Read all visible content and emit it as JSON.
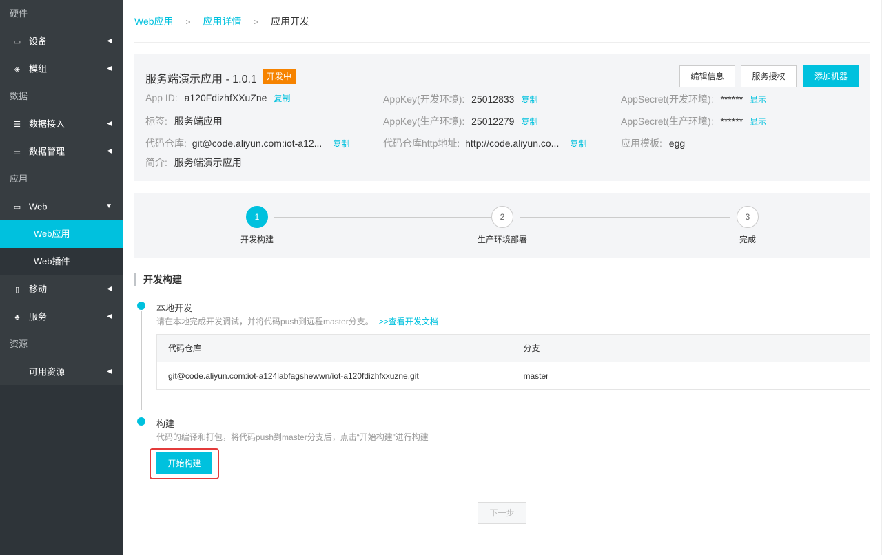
{
  "sidebar": {
    "sections": {
      "hardware": "硬件",
      "data": "数据",
      "app": "应用",
      "resources": "资源"
    },
    "items": {
      "device": {
        "label": "设备",
        "icon": "device-icon"
      },
      "module": {
        "label": "模组",
        "icon": "layers-icon"
      },
      "data_access": {
        "label": "数据接入",
        "icon": "list-icon"
      },
      "data_manage": {
        "label": "数据管理",
        "icon": "list-icon"
      },
      "web": {
        "label": "Web",
        "icon": "monitor-icon"
      },
      "web_app": {
        "label": "Web应用"
      },
      "web_plugin": {
        "label": "Web插件"
      },
      "mobile": {
        "label": "移动",
        "icon": "mobile-icon"
      },
      "service": {
        "label": "服务",
        "icon": "cluster-icon"
      },
      "available_res": {
        "label": "可用资源"
      }
    }
  },
  "breadcrumb": {
    "items": [
      "Web应用",
      "应用详情"
    ],
    "current": "应用开发",
    "separator": ">"
  },
  "app": {
    "title": "服务端演示应用 - 1.0.1",
    "status": "开发中",
    "buttons": {
      "edit": "编辑信息",
      "auth": "服务授权",
      "add_machine": "添加机器"
    },
    "info": {
      "app_id_label": "App ID:",
      "app_id_value": "a120FdizhfXXuZne",
      "appkey_dev_label": "AppKey(开发环境):",
      "appkey_dev_value": "25012833",
      "appsecret_dev_label": "AppSecret(开发环境):",
      "appsecret_dev_value": "******",
      "tag_label": "标签:",
      "tag_value": "服务端应用",
      "appkey_prod_label": "AppKey(生产环境):",
      "appkey_prod_value": "25012279",
      "appsecret_prod_label": "AppSecret(生产环境):",
      "appsecret_prod_value": "******",
      "repo_label": "代码仓库:",
      "repo_value": "git@code.aliyun.com:iot-a12...",
      "repo_http_label": "代码仓库http地址:",
      "repo_http_value": "http://code.aliyun.co...",
      "template_label": "应用模板:",
      "template_value": "egg",
      "intro_label": "简介:",
      "intro_value": "服务端演示应用",
      "copy": "复制",
      "show": "显示"
    }
  },
  "steps": [
    {
      "num": "1",
      "label": "开发构建"
    },
    {
      "num": "2",
      "label": "生产环境部署"
    },
    {
      "num": "3",
      "label": "完成"
    }
  ],
  "section_title": "开发构建",
  "timeline": {
    "local": {
      "title": "本地开发",
      "desc": "请在本地完成开发调试，并将代码push到远程master分支。",
      "doc_link": ">>查看开发文档"
    },
    "build": {
      "title": "构建",
      "desc": "代码的编译和打包，将代码push到master分支后，点击“开始构建”进行构建"
    }
  },
  "repo_table": {
    "headers": [
      "代码仓库",
      "分支"
    ],
    "rows": [
      [
        "git@code.aliyun.com:iot-a124labfagshewwn/iot-a120fdizhfxxuzne.git",
        "master"
      ]
    ]
  },
  "build_button": "开始构建",
  "next_button": "下一步",
  "colors": {
    "accent": "#00c1de",
    "badge": "#f68300",
    "sidebar": "#373d41"
  }
}
